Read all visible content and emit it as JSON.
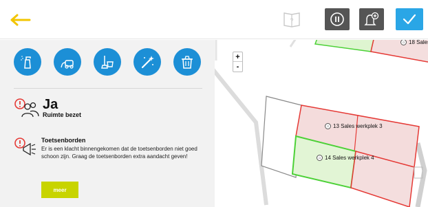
{
  "header": {
    "back_icon": "arrow-left-icon",
    "book_icon": "help-book-icon",
    "book_glyph": "?",
    "pause_icon": "pause-icon",
    "bell_icon": "bell-plus-icon",
    "check_icon": "check-icon",
    "accent_back": "#f2c500",
    "accent_check": "#2aa6e6"
  },
  "tools": [
    {
      "icon": "spray-bottle-icon"
    },
    {
      "icon": "vacuum-cleaner-icon"
    },
    {
      "icon": "mop-bucket-icon"
    },
    {
      "icon": "sparkle-wand-icon"
    },
    {
      "icon": "trash-bin-icon"
    }
  ],
  "status": {
    "icon": "occupied-alert-icon",
    "value": "Ja",
    "label": "Ruimte bezet"
  },
  "complaint": {
    "icon": "megaphone-alert-icon",
    "title": "Toetsenborden",
    "text": "Er is een klacht binnengekomen dat de toetsenborden niet goed schoon zijn. Graag de toetsenborden extra aandacht geven!",
    "button": "meer"
  },
  "map": {
    "zoom_in": "+",
    "zoom_out": "-",
    "rooms": [
      {
        "label": "18 Sales",
        "status": "occupied"
      },
      {
        "label": "13 Sales werkplek 3",
        "status": "occupied"
      },
      {
        "label": "14 Sales werkplek 4",
        "status": "free"
      }
    ]
  }
}
